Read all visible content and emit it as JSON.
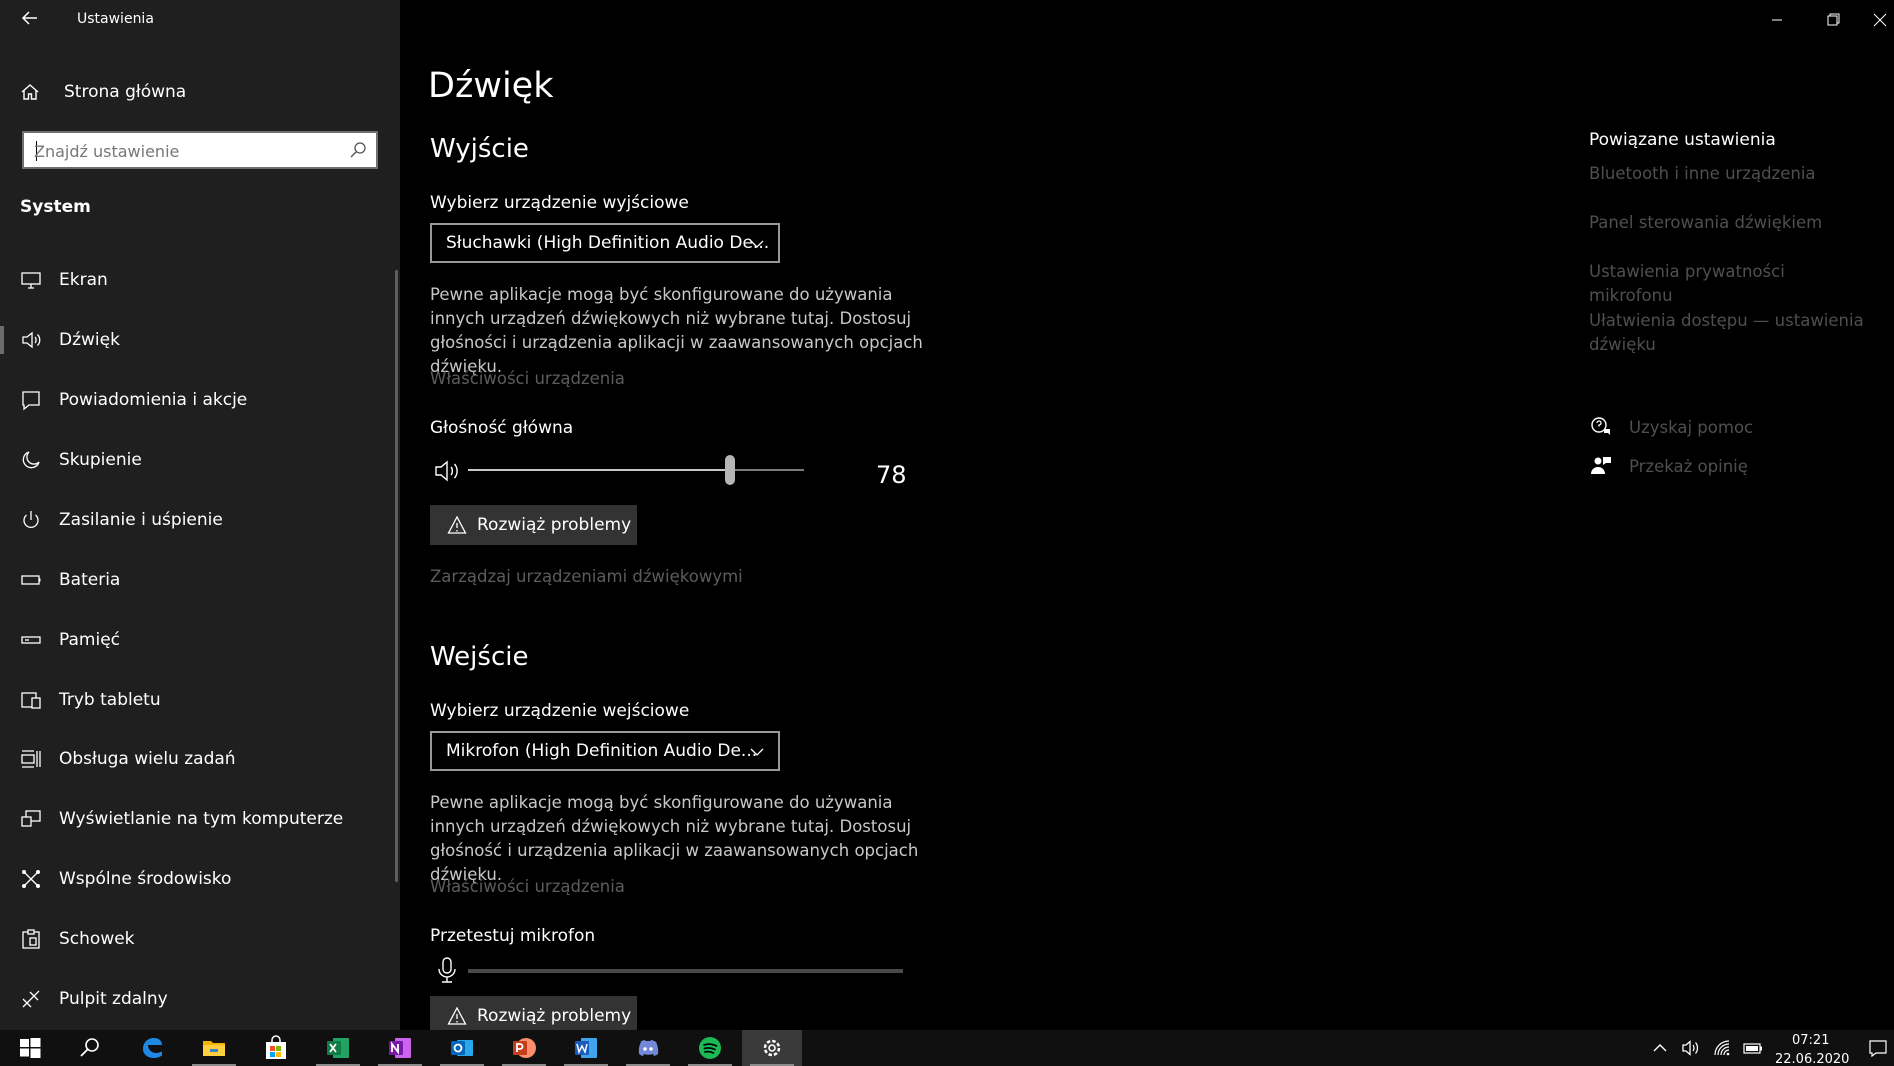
{
  "app": {
    "title": "Ustawienia"
  },
  "sidebar": {
    "home_label": "Strona główna",
    "search_placeholder": "Znajdź ustawienie",
    "section": "System",
    "items": [
      {
        "label": "Ekran",
        "icon": "monitor-icon"
      },
      {
        "label": "Dźwięk",
        "icon": "speaker-icon",
        "selected": true
      },
      {
        "label": "Powiadomienia i akcje",
        "icon": "notification-icon"
      },
      {
        "label": "Skupienie",
        "icon": "moon-icon"
      },
      {
        "label": "Zasilanie i uśpienie",
        "icon": "power-icon"
      },
      {
        "label": "Bateria",
        "icon": "battery-icon"
      },
      {
        "label": "Pamięć",
        "icon": "storage-icon"
      },
      {
        "label": "Tryb tabletu",
        "icon": "tablet-icon"
      },
      {
        "label": "Obsługa wielu zadań",
        "icon": "multitasking-icon"
      },
      {
        "label": "Wyświetlanie na tym komputerze",
        "icon": "projecting-icon"
      },
      {
        "label": "Wspólne środowisko",
        "icon": "shared-experiences-icon"
      },
      {
        "label": "Schowek",
        "icon": "clipboard-icon"
      },
      {
        "label": "Pulpit zdalny",
        "icon": "remote-desktop-icon"
      }
    ]
  },
  "main": {
    "title": "Dźwięk",
    "output": {
      "heading": "Wyjście",
      "device_label": "Wybierz urządzenie wyjściowe",
      "device_value": "Słuchawki (High Definition Audio De...",
      "description": "Pewne aplikacje mogą być skonfigurowane do używania innych urządzeń dźwiękowych niż wybrane tutaj. Dostosuj głośności i urządzenia aplikacji w zaawansowanych opcjach dźwięku.",
      "properties_link": "Właściwości urządzenia",
      "volume_label": "Głośność główna",
      "volume_value": "78",
      "volume_level": 0.78,
      "troubleshoot_label": "Rozwiąż problemy",
      "manage_link": "Zarządzaj urządzeniami dźwiękowymi"
    },
    "input": {
      "heading": "Wejście",
      "device_label": "Wybierz urządzenie wejściowe",
      "device_value": "Mikrofon (High Definition Audio De...",
      "description": "Pewne aplikacje mogą być skonfigurowane do używania innych urządzeń dźwiękowych niż wybrane tutaj. Dostosuj głośność i urządzenia aplikacji w zaawansowanych opcjach dźwięku.",
      "properties_link": "Właściwości urządzenia",
      "test_label": "Przetestuj mikrofon",
      "mic_level": 0,
      "troubleshoot_label": "Rozwiąż problemy"
    }
  },
  "related": {
    "title": "Powiązane ustawienia",
    "links": [
      "Bluetooth i inne urządzenia",
      "Panel sterowania dźwiękiem",
      "Ustawienia prywatności mikrofonu",
      "Ułatwienia dostępu — ustawienia dźwięku"
    ],
    "help": "Uzyskaj pomoc",
    "feedback": "Przekaż opinię"
  },
  "taskbar": {
    "apps": [
      "start-icon",
      "search-icon",
      "edge-icon",
      "file-explorer-icon",
      "store-icon",
      "excel-icon",
      "onenote-icon",
      "outlook-icon",
      "powerpoint-icon",
      "word-icon",
      "discord-icon",
      "spotify-icon",
      "settings-icon"
    ],
    "time": "07:21",
    "date": "22.06.2020"
  },
  "colors": {
    "background": "#000000",
    "sidebar": "#1f1f1f",
    "dim_link": "#5c5c5c",
    "button": "#333333"
  }
}
